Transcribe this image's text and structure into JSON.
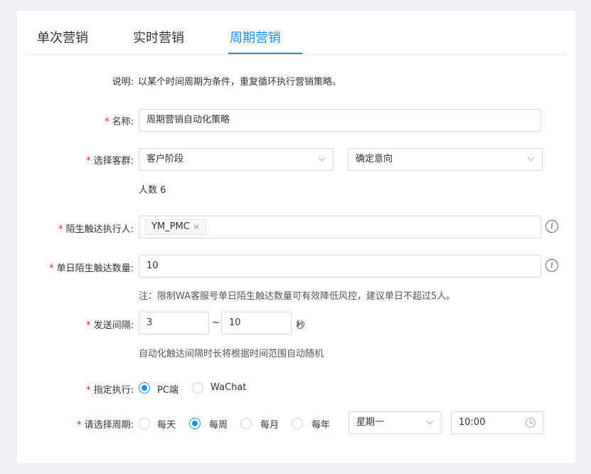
{
  "tabs": [
    {
      "label": "单次营销",
      "active": false
    },
    {
      "label": "实时营销",
      "active": false
    },
    {
      "label": "周期营销",
      "active": true
    }
  ],
  "description": {
    "label": "说明:",
    "text": "以某个时间周期为条件，重复循环执行营销策略。"
  },
  "required_mark": "*",
  "name_field": {
    "label": "名称:",
    "value": "周期营销自动化策略"
  },
  "customer_group": {
    "label": "选择客群:",
    "select1": "客户阶段",
    "select2": "确定意向",
    "count_text": "人数 6"
  },
  "executor": {
    "label": "陌生触达执行人:",
    "tag": "YM_PMC",
    "tag_remove": "×"
  },
  "daily_count": {
    "label": "单日陌生触达数量:",
    "value": "10",
    "note": "注：限制WA客服号单日陌生触达数量可有效降低风控，建议单日不超过5人。"
  },
  "interval": {
    "label": "发送间隔:",
    "min": "3",
    "separator": "~",
    "max": "10",
    "unit": "秒",
    "note": "自动化触达间隔时长将根据时间范围自动随机"
  },
  "execute_on": {
    "label": "指定执行:",
    "options": [
      {
        "label": "PC端",
        "checked": true
      },
      {
        "label": "WaChat",
        "checked": false
      }
    ]
  },
  "period": {
    "label": "请选择周期:",
    "options": [
      {
        "label": "每天",
        "checked": false
      },
      {
        "label": "每周",
        "checked": true
      },
      {
        "label": "每月",
        "checked": false
      },
      {
        "label": "每年",
        "checked": false
      }
    ],
    "weekday": "星期一",
    "time": "10:00"
  },
  "icons": {
    "info": "info-circle-icon",
    "chevron": "chevron-down-icon",
    "clock": "clock-icon",
    "close": "close-icon"
  },
  "colors": {
    "accent": "#1890ff",
    "required": "#f5222d"
  }
}
